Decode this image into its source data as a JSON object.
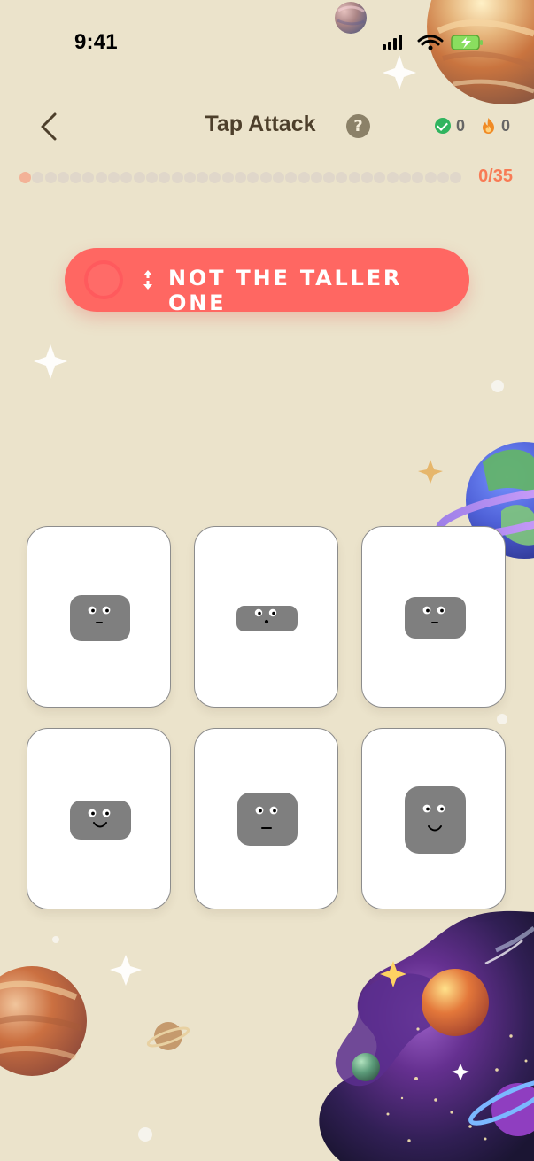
{
  "status_bar": {
    "time": "9:41",
    "icons": [
      "signal-icon",
      "wifi-icon",
      "battery-charging-icon"
    ]
  },
  "header": {
    "title": "Tap Attack",
    "help": "?",
    "correct_count": "0",
    "streak_count": "0"
  },
  "progress": {
    "current": 0,
    "total": 35,
    "label": "0/35"
  },
  "prompt": {
    "text": "NOT THE TALLER ONE",
    "icon": "height-icon"
  },
  "cards": [
    {
      "id": "card-1",
      "mouth": "dash"
    },
    {
      "id": "card-2",
      "mouth": "dot"
    },
    {
      "id": "card-3",
      "mouth": "dash"
    },
    {
      "id": "card-4",
      "mouth": "smile"
    },
    {
      "id": "card-5",
      "mouth": "line"
    },
    {
      "id": "card-6",
      "mouth": "smile"
    }
  ],
  "colors": {
    "background": "#ebe3cb",
    "accent": "#ff6762",
    "progress": "#f87b55",
    "face": "#7f7f7f",
    "card": "#ffffff",
    "correct": "#30b45f",
    "streak": "#f08a24"
  }
}
